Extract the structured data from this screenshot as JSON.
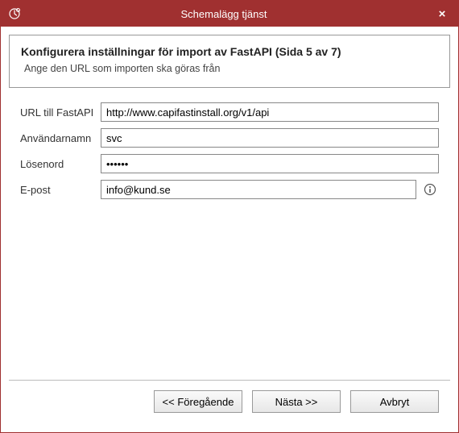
{
  "titlebar": {
    "title": "Schemalägg tjänst",
    "close": "×"
  },
  "header": {
    "heading": "Konfigurera inställningar för import av FastAPI (Sida 5 av 7)",
    "subheading": "Ange den URL som importen ska göras från"
  },
  "form": {
    "url_label": "URL till FastAPI",
    "url_value": "http://www.capifastinstall.org/v1/api",
    "username_label": "Användarnamn",
    "username_value": "svc",
    "password_label": "Lösenord",
    "password_value": "••••••",
    "email_label": "E-post",
    "email_value": "info@kund.se"
  },
  "buttons": {
    "prev": "<< Föregående",
    "next": "Nästa >>",
    "cancel": "Avbryt"
  }
}
